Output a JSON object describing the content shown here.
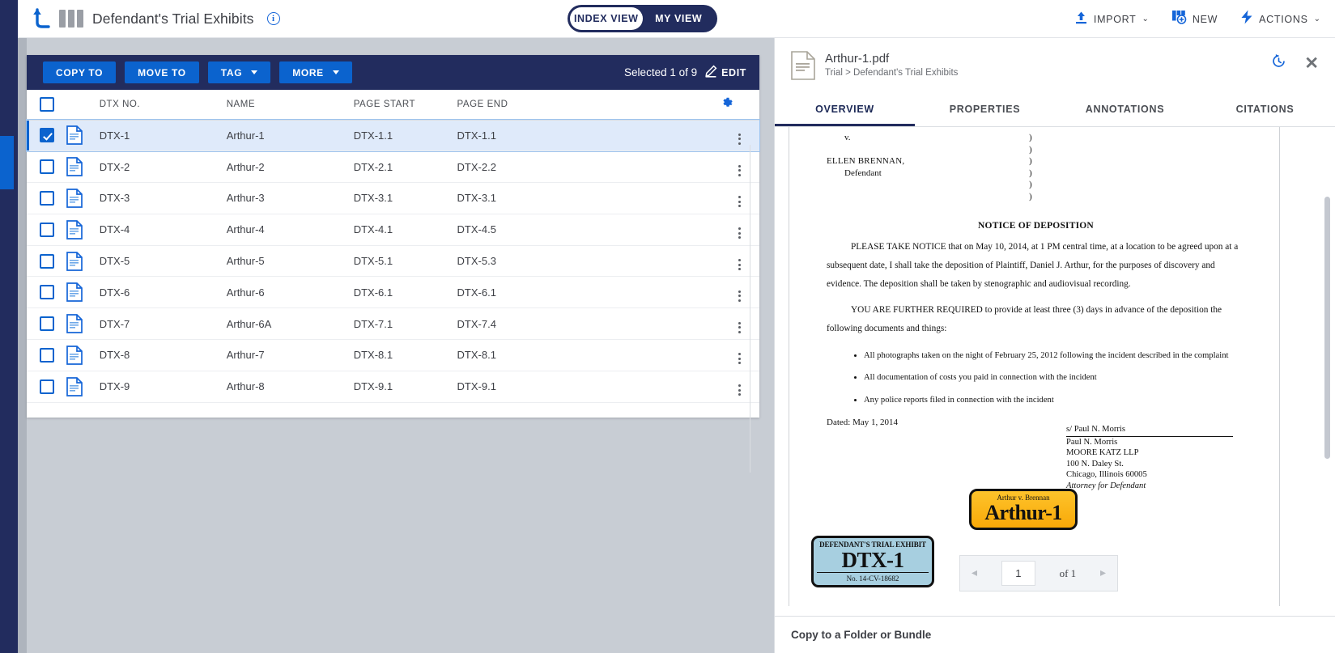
{
  "topbar": {
    "app_title": "Defendant's Trial Exhibits",
    "info_tooltip": "i",
    "view_toggle": {
      "index_view": "INDEX VIEW",
      "my_view": "MY VIEW",
      "active": "INDEX VIEW"
    },
    "actions": [
      {
        "label": "IMPORT",
        "icon": "upload-icon",
        "has_caret": true
      },
      {
        "label": "NEW",
        "icon": "new-document-icon",
        "has_caret": false
      },
      {
        "label": "ACTIONS",
        "icon": "lightning-bolt-icon",
        "has_caret": true
      }
    ],
    "caret": "⌄"
  },
  "grid": {
    "toolbar": {
      "copy_to": "COPY TO",
      "move_to": "MOVE TO",
      "tag": "TAG",
      "more": "MORE",
      "selected_text": "Selected 1 of 9",
      "edit": "EDIT"
    },
    "columns": [
      "DTX NO.",
      "NAME",
      "PAGE START",
      "PAGE END"
    ],
    "rows": [
      {
        "dtx": "DTX-1",
        "name": "Arthur-1",
        "page_start": "DTX-1.1",
        "page_end": "DTX-1.1",
        "selected": true
      },
      {
        "dtx": "DTX-2",
        "name": "Arthur-2",
        "page_start": "DTX-2.1",
        "page_end": "DTX-2.2",
        "selected": false
      },
      {
        "dtx": "DTX-3",
        "name": "Arthur-3",
        "page_start": "DTX-3.1",
        "page_end": "DTX-3.1",
        "selected": false
      },
      {
        "dtx": "DTX-4",
        "name": "Arthur-4",
        "page_start": "DTX-4.1",
        "page_end": "DTX-4.5",
        "selected": false
      },
      {
        "dtx": "DTX-5",
        "name": "Arthur-5",
        "page_start": "DTX-5.1",
        "page_end": "DTX-5.3",
        "selected": false
      },
      {
        "dtx": "DTX-6",
        "name": "Arthur-6",
        "page_start": "DTX-6.1",
        "page_end": "DTX-6.1",
        "selected": false
      },
      {
        "dtx": "DTX-7",
        "name": "Arthur-6A",
        "page_start": "DTX-7.1",
        "page_end": "DTX-7.4",
        "selected": false
      },
      {
        "dtx": "DTX-8",
        "name": "Arthur-7",
        "page_start": "DTX-8.1",
        "page_end": "DTX-8.1",
        "selected": false
      },
      {
        "dtx": "DTX-9",
        "name": "Arthur-8",
        "page_start": "DTX-9.1",
        "page_end": "DTX-9.1",
        "selected": false
      }
    ]
  },
  "preview": {
    "file_name": "Arthur-1.pdf",
    "breadcrumb": "Trial > Defendant's Trial Exhibits",
    "tabs": [
      "OVERVIEW",
      "PROPERTIES",
      "ANNOTATIONS",
      "CITATIONS"
    ],
    "active_tab": "OVERVIEW",
    "close_glyph": "✕",
    "document": {
      "caption_v": "v.",
      "caption_party": "ELLEN BRENNAN,",
      "caption_role": "Defendant",
      "heading": "NOTICE OF DEPOSITION",
      "para1": "PLEASE TAKE NOTICE that on May 10, 2014, at 1 PM central time, at a location to be agreed upon at a subsequent date, I shall take the deposition of Plaintiff, Daniel J. Arthur, for the purposes of discovery and evidence. The deposition shall be taken by stenographic and audiovisual recording.",
      "para2": "YOU ARE FURTHER REQUIRED to provide at least three (3) days in advance of the deposition the following documents and things:",
      "bullets": [
        "All photographs taken on the night of February 25, 2012 following the incident described in the complaint",
        "All documentation of costs you paid in connection with the incident",
        "Any police reports filed in connection with the incident"
      ],
      "dated": "Dated:  May 1, 2014",
      "signature": {
        "line": "s/ Paul N. Morris",
        "name": "Paul N. Morris",
        "firm": "MOORE KATZ LLP",
        "address1": "100 N. Daley St.",
        "address2": "Chicago, Illinois 60005",
        "role": "Attorney for Defendant"
      },
      "stamp_dtx": {
        "top": "DEFENDANT'S TRIAL EXHIBIT",
        "main": "DTX-1",
        "bottom": "No. 14-CV-18682"
      },
      "stamp_arthur": {
        "top": "Arthur v. Brennan",
        "main": "Arthur-1"
      }
    },
    "pager": {
      "current": "1",
      "of_text": "of 1",
      "prev": "◂",
      "next": "▸"
    },
    "bottom_bar": "Copy to a Folder or Bundle"
  },
  "colors": {
    "navy": "#222c5e",
    "blue": "#0b63ce",
    "selection_row": "#dfeafa",
    "stamp_dtx_bg": "#a7cfe0",
    "stamp_arthur_bg": "#fdb515"
  }
}
